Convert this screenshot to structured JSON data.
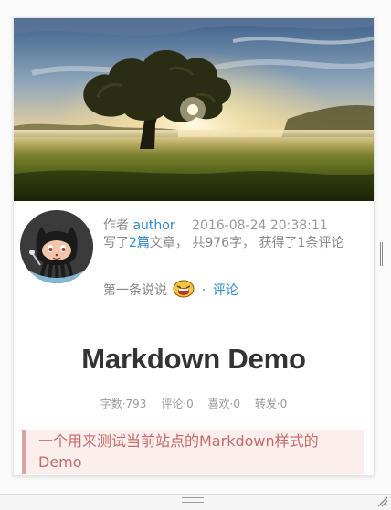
{
  "post": {
    "author_prefix": "作者",
    "author_name": "author",
    "date": "2016-08-24 20:38:11",
    "stats_pre": "写了",
    "article_count": "2篇",
    "stats_rest": "文章， 共976字， 获得了1条评论",
    "first_comment_label": "第一条说说",
    "separator": "·",
    "comment_link": "评论",
    "title": "Markdown Demo",
    "stats": {
      "words": "字数·793",
      "comments": "评论·0",
      "likes": "喜欢·0",
      "reposts": "转发·0"
    },
    "quote_line1": "一个用来测试当前站点的Markdown样式的",
    "quote_line2": "Demo"
  },
  "icons": {
    "avatar": "github-octocat-avatar",
    "emoji": "laughing-face-icon",
    "scroll": "scroll-handle-icon",
    "resize": "resize-grip-icon"
  }
}
